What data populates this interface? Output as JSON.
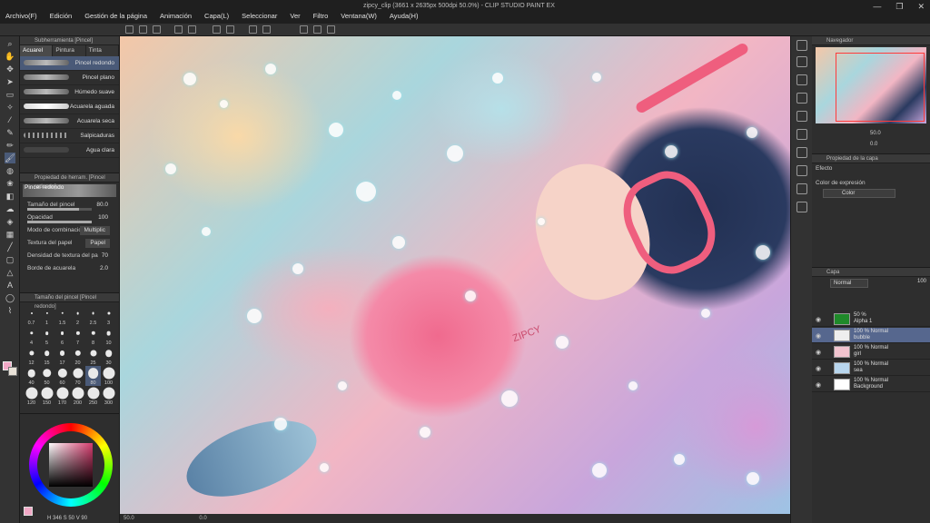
{
  "window": {
    "title": "zipcy_clip (3661 x 2635px 500dpi 50.0%)  - CLIP STUDIO PAINT EX",
    "buttons": [
      "—",
      "❐",
      "✕"
    ]
  },
  "menu": [
    "Archivo(F)",
    "Edición",
    "Gestión de la página",
    "Animación",
    "Capa(L)",
    "Seleccionar",
    "Ver",
    "Filtro",
    "Ventana(W)",
    "Ayuda(H)"
  ],
  "subtool": {
    "header": "Subherramienta [Pincel]",
    "tabs": [
      "Acuarel",
      "Pintura",
      "Tinta"
    ],
    "brushes": [
      "Pincel redondo",
      "Pincel plano",
      "Húmedo suave",
      "Acuarela aguada",
      "Acuarela seca",
      "Salpicaduras",
      "Agua clara"
    ]
  },
  "toolprop": {
    "header": "Propiedad de herram. [Pincel redondo]",
    "preset": "Pincel redondo",
    "brush_size_label": "Tamaño del pincel",
    "brush_size_value": "80.0",
    "brush_size_fraction": 0.8,
    "opacity_label": "Opacidad",
    "opacity_value": "100",
    "opacity_fraction": 1.0,
    "blend_label": "Modo de combinación",
    "blend_value": "Multiplic",
    "texture_label": "Textura del papel",
    "texture_value": "Papel",
    "density_label": "Densidad de textura del pa",
    "density_value": "70",
    "edge_label": "Borde de acuarela",
    "edge_value": "2.0"
  },
  "brushsize": {
    "header": "Tamaño del pincel [Pincel redondo]",
    "sizes": [
      "0.7",
      "1",
      "1.5",
      "2",
      "2.5",
      "3",
      "4",
      "5",
      "6",
      "7",
      "8",
      "10",
      "12",
      "15",
      "17",
      "20",
      "25",
      "30",
      "40",
      "50",
      "60",
      "70",
      "80",
      "100",
      "120",
      "150",
      "170",
      "200",
      "250",
      "300"
    ],
    "selected": "80"
  },
  "color": {
    "main": "#f2a8c6",
    "sub": "#e9e2d8",
    "readout": "H 346   S 50   V 90"
  },
  "canvas": {
    "zoom": "50.0",
    "status": "0.0"
  },
  "navigator": {
    "header": "Navegador",
    "zoom": "50.0",
    "rotation": "0.0"
  },
  "layerprop": {
    "header": "Propiedad de la capa",
    "effect_label": "Efecto",
    "expr_label": "Color de expresión",
    "expr_value": "Color"
  },
  "layers": {
    "header": "Capa",
    "blend": "Normal",
    "opacity": "100",
    "items": [
      {
        "line1": "50 %",
        "line2": "Alpha 1",
        "thumb": "#1f8a2a"
      },
      {
        "line1": "100 % Normal",
        "line2": "bubble",
        "thumb": "#eeeeee"
      },
      {
        "line1": "100 % Normal",
        "line2": "girl",
        "thumb": "#f2c4cf"
      },
      {
        "line1": "100 % Normal",
        "line2": "sea",
        "thumb": "#b8d6ee"
      },
      {
        "line1": "100 % Normal",
        "line2": "Background",
        "thumb": "#ffffff"
      }
    ]
  },
  "art": {
    "watermark": "ZIPCY"
  }
}
